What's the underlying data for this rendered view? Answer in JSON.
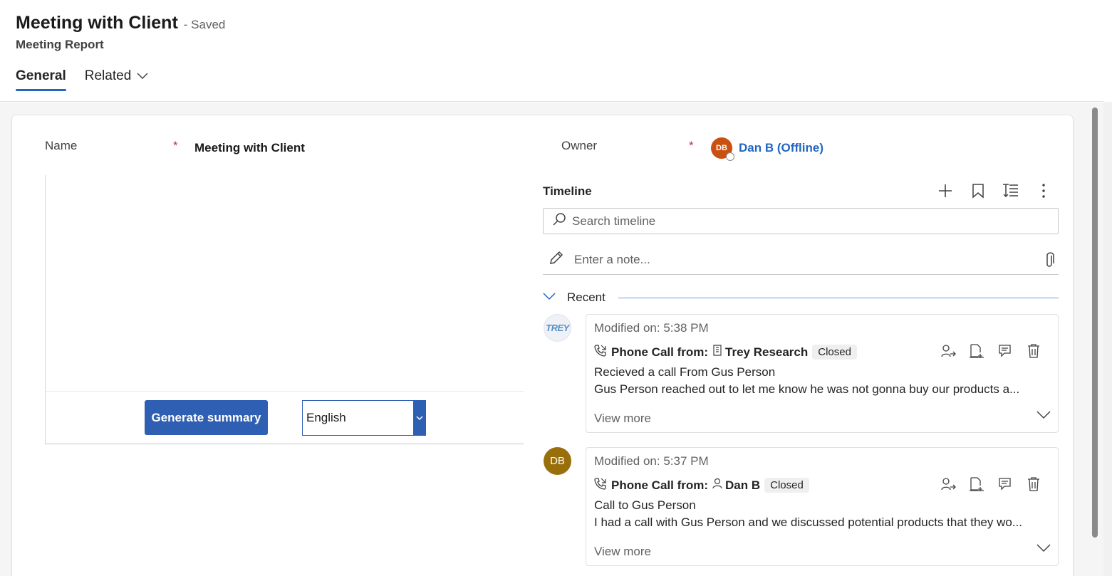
{
  "header": {
    "title": "Meeting with Client",
    "status": "- Saved",
    "subtitle": "Meeting Report",
    "tabs": [
      {
        "label": "General",
        "active": true
      },
      {
        "label": "Related",
        "active": false
      }
    ]
  },
  "form": {
    "name_label": "Name",
    "name_value": "Meeting with Client",
    "owner_label": "Owner",
    "owner_initials": "DB",
    "owner_value": "Dan B (Offline)",
    "required_mark": "*"
  },
  "embed": {
    "generate_button": "Generate summary",
    "language_value": "English"
  },
  "timeline": {
    "title": "Timeline",
    "search_placeholder": "Search timeline",
    "note_placeholder": "Enter a note...",
    "recent_label": "Recent",
    "entries": [
      {
        "avatar_text": "TREY",
        "modified": "Modified on: 5:38 PM",
        "type": "Phone Call from:",
        "regarding": "Trey Research",
        "status": "Closed",
        "subject": "Recieved a call From Gus Person",
        "description": "Gus Person reached out to let me know he was not gonna buy our products a...",
        "view_more": "View more"
      },
      {
        "avatar_text": "DB",
        "modified": "Modified on: 5:37 PM",
        "type": "Phone Call from:",
        "regarding": "Dan B",
        "status": "Closed",
        "subject": "Call to Gus Person",
        "description": "I had a call with Gus Person and we discussed potential products that they wo...",
        "view_more": "View more"
      }
    ]
  },
  "colors": {
    "accent": "#2266c2",
    "button": "#2f5fb3",
    "owner_avatar": "#ca5010",
    "db_avatar": "#986f0b",
    "required": "#c4314b"
  },
  "icons": [
    "chevron-down-icon",
    "presence-offline-icon",
    "add-icon",
    "bookmark-icon",
    "sort-icon",
    "more-icon",
    "search-icon",
    "pencil-icon",
    "attachment-icon",
    "phone-call-icon",
    "account-icon",
    "contact-icon",
    "assign-icon",
    "add-to-queue-icon",
    "convert-icon",
    "delete-icon"
  ]
}
